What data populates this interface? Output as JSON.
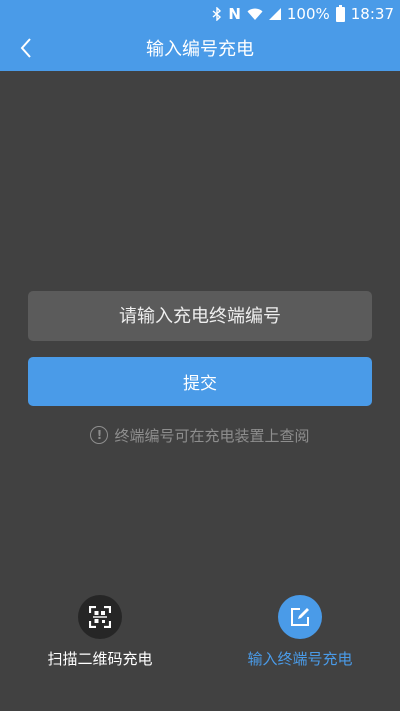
{
  "status_bar": {
    "battery": "100%",
    "time": "18:37",
    "icons": [
      "bluetooth-icon",
      "nfc-icon",
      "wifi-icon",
      "signal-icon",
      "battery-icon"
    ]
  },
  "header": {
    "back_icon": "chevron-left-icon",
    "title": "输入编号充电"
  },
  "form": {
    "terminal_placeholder": "请输入充电终端编号",
    "terminal_value": "",
    "submit_label": "提交",
    "hint_icon": "info-circle-icon",
    "hint_text": "终端编号可在充电装置上查阅"
  },
  "bottom_nav": {
    "items": [
      {
        "label": "扫描二维码充电",
        "icon": "qr-scan-icon",
        "active": false
      },
      {
        "label": "输入终端号充电",
        "icon": "edit-icon",
        "active": true
      }
    ]
  },
  "colors": {
    "accent": "#4a9be8",
    "background": "#414141",
    "input_bg": "#5b5b5b",
    "hint": "#8e8e8e"
  }
}
